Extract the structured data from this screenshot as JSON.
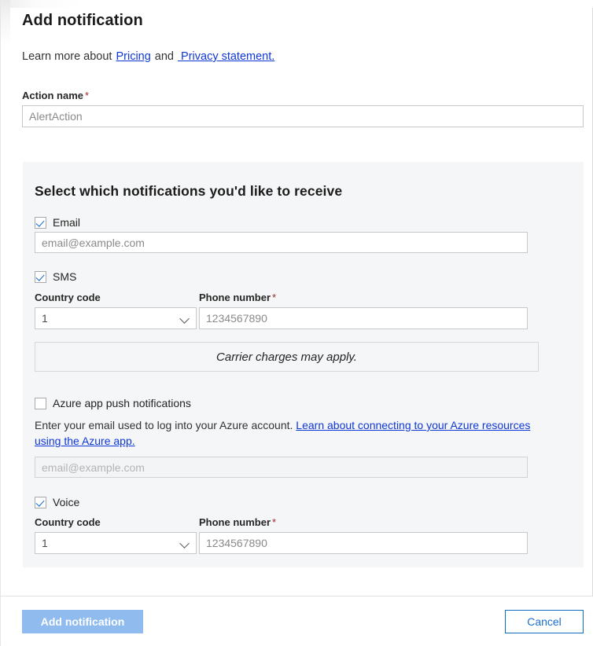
{
  "blade": {
    "title": "Add notification"
  },
  "intro": {
    "lead": "Learn more about",
    "pricing_link": "Pricing",
    "conjunction": "and",
    "privacy_link": " Privacy statement."
  },
  "action_name": {
    "label": "Action name",
    "required_marker": "*",
    "value": "",
    "placeholder": "AlertAction"
  },
  "panel": {
    "title": "Select which notifications you'd like to receive",
    "email": {
      "checkbox_label": "Email",
      "checked": true,
      "value": "",
      "placeholder": "email@example.com"
    },
    "sms": {
      "checkbox_label": "SMS",
      "checked": true,
      "country_code_label": "Country code",
      "country_code_value": "1",
      "phone_label": "Phone number",
      "phone_required_marker": "*",
      "phone_value": "",
      "phone_placeholder": "1234567890"
    },
    "carrier_notice": "Carrier charges may apply.",
    "push": {
      "checkbox_label": "Azure app push notifications",
      "checked": false,
      "help_text": "Enter your email used to log into your Azure account.",
      "help_link": "Learn about connecting to your Azure resources using the Azure app.",
      "value": "",
      "placeholder": "email@example.com"
    },
    "voice": {
      "checkbox_label": "Voice",
      "checked": true,
      "country_code_label": "Country code",
      "country_code_value": "1",
      "phone_label": "Phone number",
      "phone_required_marker": "*",
      "phone_value": "",
      "phone_placeholder": "1234567890"
    }
  },
  "footer": {
    "primary_label": "Add notification",
    "secondary_label": "Cancel"
  },
  "colors": {
    "link": "#0f37d6",
    "required": "#a4262c",
    "checkmark": "#0b69d4",
    "primary_button_bg": "#8fbbee",
    "secondary_button_border": "#0f6cbd",
    "panel_bg": "#f5f6f7"
  }
}
